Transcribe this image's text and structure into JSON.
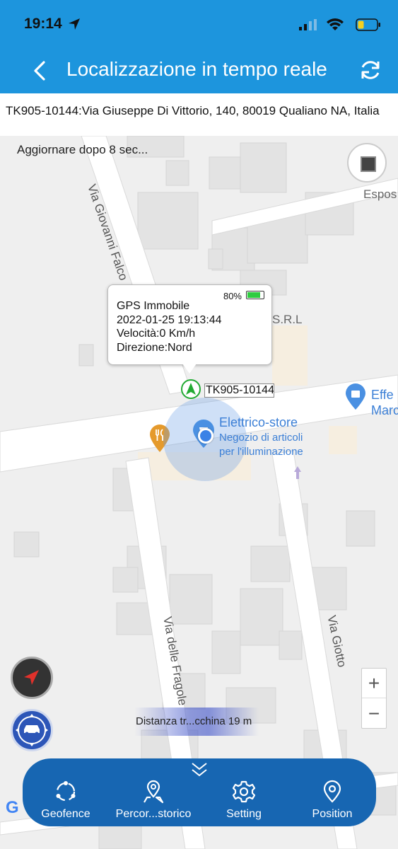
{
  "status_bar": {
    "time": "19:14"
  },
  "navbar": {
    "title": "Localizzazione in tempo reale"
  },
  "address": {
    "text": "TK905-10144:Via Giuseppe Di Vittorio, 140, 80019 Qualiano NA, Italia"
  },
  "map": {
    "update_text": "Aggiornare dopo 8 sec...",
    "streets": [
      "Via Giovanni Falco",
      "Via delle Fragole",
      "Via Giotto"
    ],
    "labels": {
      "espos": "Espos",
      "srl": "S.R.L",
      "effe": "Effe",
      "marc": "Marc"
    },
    "poi": {
      "name": "Elettrico-store",
      "subtitle_line1": "Negozio di articoli",
      "subtitle_line2": "per l'illuminazione"
    },
    "google": "G"
  },
  "popup": {
    "battery_pct": "80%",
    "battery_level": 0.8,
    "status": "GPS Immobile",
    "datetime": "2022-01-25 19:13:44",
    "speed": "Velocità:0 Km/h",
    "direction": "Direzione:Nord"
  },
  "vehicle": {
    "label": "TK905-10144"
  },
  "distance": {
    "text": "Distanza tr...cchina 19 m"
  },
  "zoom": {
    "in": "+",
    "out": "−"
  },
  "bottom_bar": {
    "items": [
      {
        "label": "Geofence",
        "icon": "geofence-icon"
      },
      {
        "label": "Percor...storico",
        "icon": "route-history-icon"
      },
      {
        "label": "Setting",
        "icon": "gear-icon"
      },
      {
        "label": "Position",
        "icon": "location-pin-icon"
      }
    ]
  },
  "colors": {
    "header": "#1d95dd",
    "bottom_bar": "#1766b2",
    "accent_green": "#22aa33"
  }
}
